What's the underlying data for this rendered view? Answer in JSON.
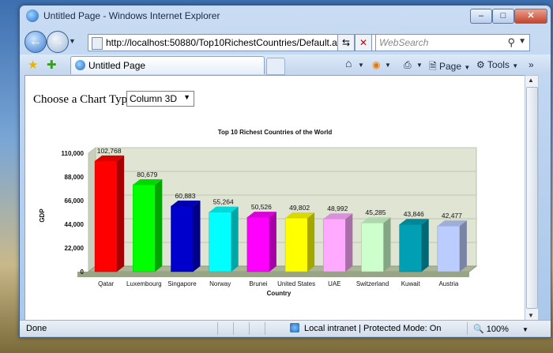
{
  "window": {
    "title": "Untitled Page - Windows Internet Explorer",
    "minimize": "–",
    "maximize": "□",
    "close": "✕"
  },
  "address_bar": {
    "url": "http://localhost:50880/Top10RichestCountries/Default.aspx",
    "search_placeholder": "WebSearch"
  },
  "tab": {
    "label": "Untitled Page"
  },
  "toolbar": {
    "page_label": "Page",
    "tools_label": "Tools"
  },
  "page": {
    "prompt": "Choose a Chart Type:",
    "chart_type_selected": "Column 3D"
  },
  "status_bar": {
    "status": "Done",
    "zone": "Local intranet | Protected Mode: On",
    "zoom": "100%"
  },
  "chart_data": {
    "type": "bar",
    "title": "Top 10 Richest Countries of the World",
    "xlabel": "Country",
    "ylabel": "GDP",
    "ylim": [
      0,
      110000
    ],
    "yticks": [
      "0",
      "22,000",
      "44,000",
      "66,000",
      "88,000",
      "110,000"
    ],
    "categories": [
      "Qatar",
      "Luxembourg",
      "Singapore",
      "Norway",
      "Brunei",
      "United States",
      "UAE",
      "Switzerland",
      "Kuwait",
      "Austria"
    ],
    "values": [
      102768,
      80679,
      60883,
      55264,
      50526,
      49802,
      48992,
      45285,
      43846,
      42477
    ],
    "value_labels": [
      "102,768",
      "80,679",
      "60,883",
      "55,264",
      "50,526",
      "49,802",
      "48,992",
      "45,285",
      "43,846",
      "42,477"
    ],
    "colors": [
      "#ff0000",
      "#00ff00",
      "#0000cc",
      "#00ffff",
      "#ff00ff",
      "#ffff00",
      "#ffaaff",
      "#ccffcc",
      "#009fb3",
      "#bbccff"
    ],
    "grid": true,
    "style": "3d-column"
  }
}
